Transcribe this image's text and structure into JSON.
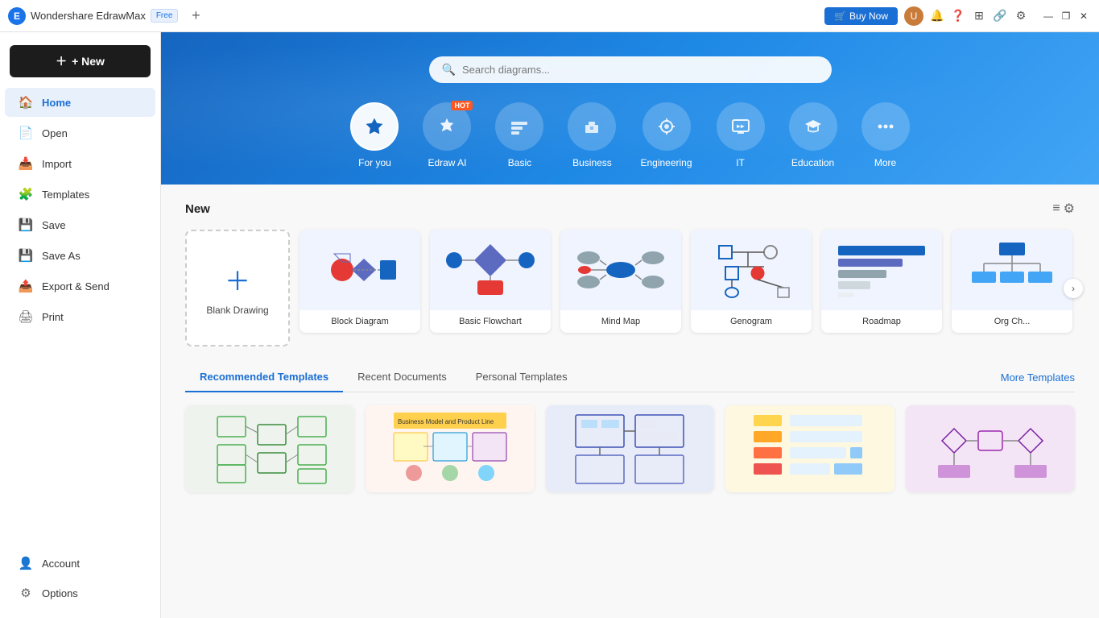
{
  "titlebar": {
    "app_name": "Wondershare EdrawMax",
    "free_badge": "Free",
    "add_tab": "+",
    "buy_now": "Buy Now",
    "minimize": "—",
    "maximize": "❐",
    "close": "✕"
  },
  "sidebar": {
    "new_label": "+ New",
    "items": [
      {
        "id": "home",
        "label": "Home",
        "icon": "🏠",
        "active": true
      },
      {
        "id": "open",
        "label": "Open",
        "icon": "📄"
      },
      {
        "id": "import",
        "label": "Import",
        "icon": "📥"
      },
      {
        "id": "templates",
        "label": "Templates",
        "icon": "🧩"
      },
      {
        "id": "save",
        "label": "Save",
        "icon": "💾"
      },
      {
        "id": "save_as",
        "label": "Save As",
        "icon": "💾"
      },
      {
        "id": "export",
        "label": "Export & Send",
        "icon": "📤"
      },
      {
        "id": "print",
        "label": "Print",
        "icon": "🖨"
      }
    ],
    "bottom_items": [
      {
        "id": "account",
        "label": "Account",
        "icon": "👤"
      },
      {
        "id": "options",
        "label": "Options",
        "icon": "⚙"
      }
    ]
  },
  "banner": {
    "search_placeholder": "Search diagrams...",
    "categories": [
      {
        "id": "for_you",
        "label": "For you",
        "icon": "✏",
        "active": true,
        "hot": false
      },
      {
        "id": "edraw_ai",
        "label": "Edraw AI",
        "icon": "⚡",
        "active": false,
        "hot": true
      },
      {
        "id": "basic",
        "label": "Basic",
        "icon": "🏷",
        "active": false,
        "hot": false
      },
      {
        "id": "business",
        "label": "Business",
        "icon": "💼",
        "active": false,
        "hot": false
      },
      {
        "id": "engineering",
        "label": "Engineering",
        "icon": "⚙",
        "active": false,
        "hot": false
      },
      {
        "id": "it",
        "label": "IT",
        "icon": "🖥",
        "active": false,
        "hot": false
      },
      {
        "id": "education",
        "label": "Education",
        "icon": "🎓",
        "active": false,
        "hot": false
      },
      {
        "id": "more",
        "label": "More",
        "icon": "⋯",
        "active": false,
        "hot": false
      }
    ]
  },
  "new_section": {
    "title": "New",
    "blank_drawing_label": "Blank Drawing",
    "cards": [
      {
        "id": "block",
        "label": "Block Diagram"
      },
      {
        "id": "flowchart",
        "label": "Basic Flowchart"
      },
      {
        "id": "mindmap",
        "label": "Mind Map"
      },
      {
        "id": "genogram",
        "label": "Genogram"
      },
      {
        "id": "roadmap",
        "label": "Roadmap"
      },
      {
        "id": "orgchart",
        "label": "Org Ch..."
      }
    ]
  },
  "templates_section": {
    "tabs": [
      {
        "id": "recommended",
        "label": "Recommended Templates",
        "active": true
      },
      {
        "id": "recent",
        "label": "Recent Documents",
        "active": false
      },
      {
        "id": "personal",
        "label": "Personal Templates",
        "active": false
      }
    ],
    "more_templates_label": "More Templates",
    "thumbnails": [
      {
        "id": "t1",
        "bg": "#e8f0e8"
      },
      {
        "id": "t2",
        "bg": "#fff0e8"
      },
      {
        "id": "t3",
        "bg": "#e8ecf8"
      },
      {
        "id": "t4",
        "bg": "#f0e8f8"
      },
      {
        "id": "t5",
        "bg": "#e8f4f8"
      }
    ]
  }
}
